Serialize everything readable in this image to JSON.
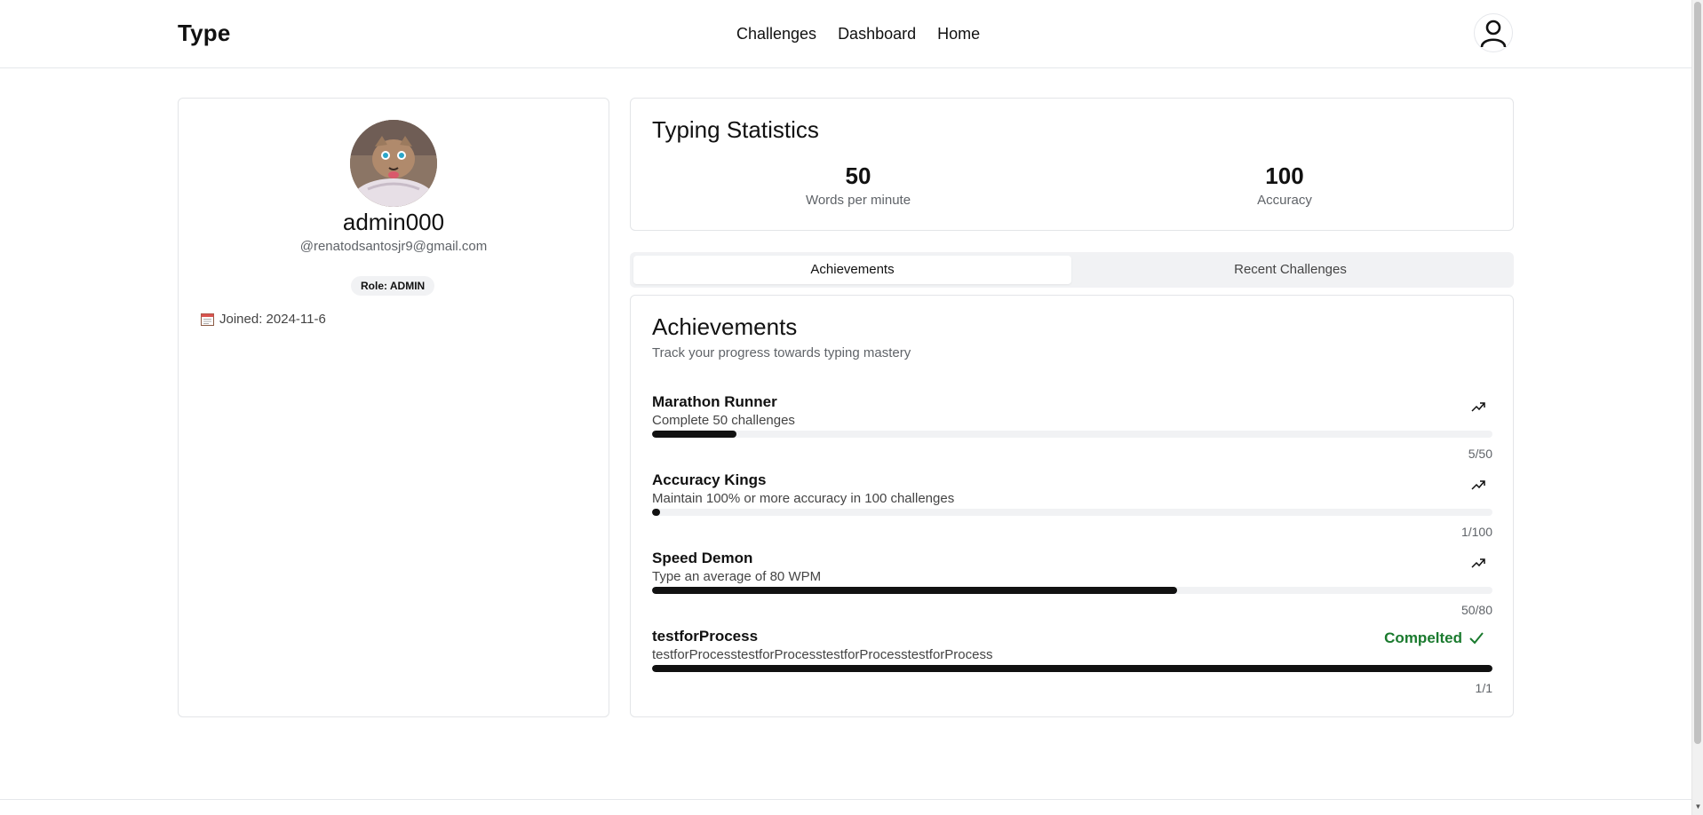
{
  "header": {
    "brand": "Type",
    "nav": [
      {
        "label": "Challenges"
      },
      {
        "label": "Dashboard"
      },
      {
        "label": "Home"
      }
    ],
    "user_icon": "user-icon"
  },
  "profile": {
    "username": "admin000",
    "email": "@renatodsantosjr9@gmail.com",
    "role": "Role: ADMIN",
    "joined": "Joined: 2024-11-6",
    "calendar_icon": "calendar-icon"
  },
  "stats": {
    "title": "Typing Statistics",
    "wpm_value": "50",
    "wpm_label": "Words per minute",
    "accuracy_value": "100",
    "accuracy_label": "Accuracy"
  },
  "tabs": [
    {
      "label": "Achievements",
      "active": true
    },
    {
      "label": "Recent Challenges",
      "active": false
    }
  ],
  "achievements": {
    "title": "Achievements",
    "subtitle": "Track your progress towards typing mastery",
    "items": [
      {
        "name": "Marathon Runner",
        "description": "Complete 50 challenges",
        "current": 5,
        "target": 50,
        "progress_text": "5/50",
        "completed": false,
        "icon": "trending-up-icon"
      },
      {
        "name": "Accuracy Kings",
        "description": "Maintain 100% or more accuracy in 100 challenges",
        "current": 1,
        "target": 100,
        "progress_text": "1/100",
        "completed": false,
        "icon": "trending-up-icon"
      },
      {
        "name": "Speed Demon",
        "description": "Type an average of 80 WPM",
        "current": 50,
        "target": 80,
        "progress_text": "50/80",
        "completed": false,
        "icon": "trending-up-icon"
      },
      {
        "name": "testforProcess",
        "description": "testforProcesstestforProcesstestforProcesstestforProcess",
        "current": 1,
        "target": 1,
        "progress_text": "1/1",
        "completed": true,
        "completed_label": "Compelted",
        "icon": "check-icon"
      }
    ]
  },
  "colors": {
    "accent": "#111111",
    "completed": "#1a7a2e",
    "track": "#f1f2f4"
  }
}
